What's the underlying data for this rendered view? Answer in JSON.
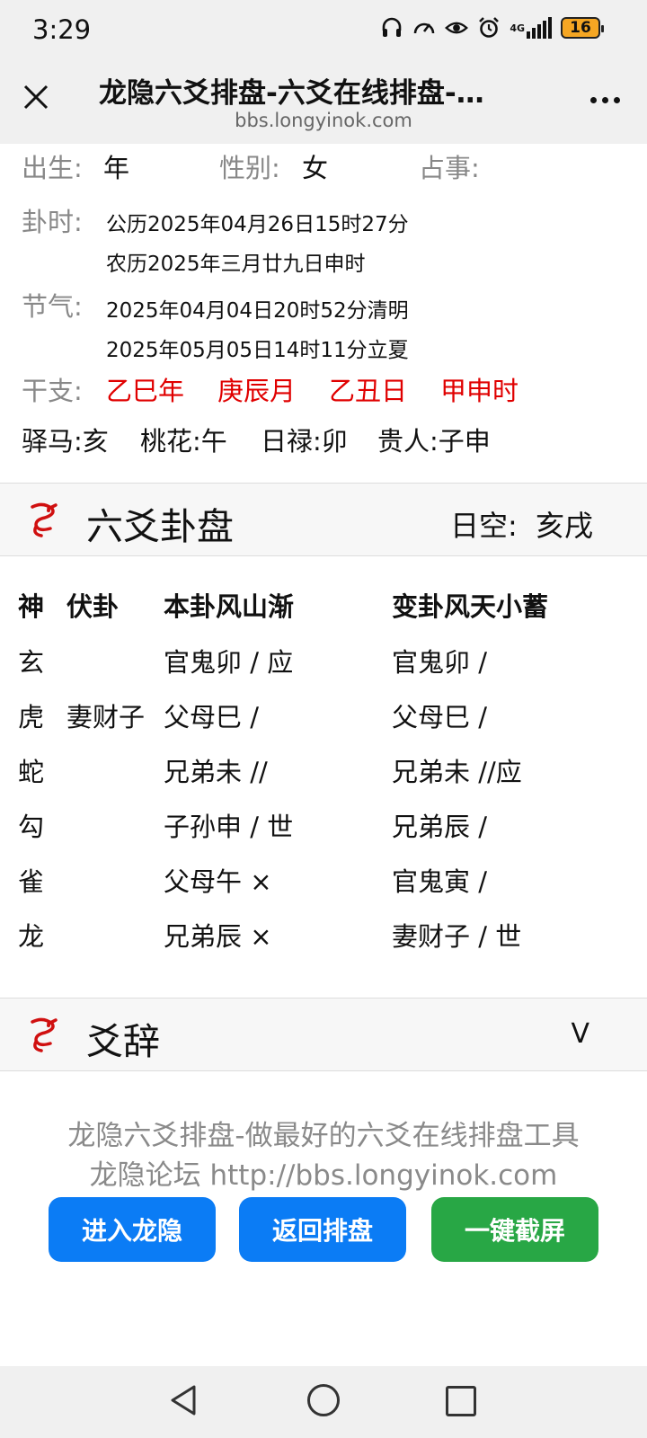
{
  "status_bar": {
    "time": "3:29",
    "icons": [
      "headphones-icon",
      "speed-icon",
      "eye-icon",
      "alarm-icon",
      "signal-icon"
    ],
    "network": "4G",
    "battery": "16",
    "battery_color": "#f5a623"
  },
  "browser": {
    "title": "龙隐六爻排盘-六爻在线排盘-…",
    "url": "bbs.longyinok.com"
  },
  "info": {
    "birth_label": "出生:",
    "birth_value": "年",
    "gender_label": "性别:",
    "gender_value": "女",
    "matter_label": "占事:",
    "gua_time_label": "卦时:",
    "gua_time_solar": "公历2025年04月26日15时27分",
    "gua_time_lunar": "农历2025年三月廿九日申时",
    "solar_term_label": "节气:",
    "solar_term_1": "2025年04月04日20时52分清明",
    "solar_term_2": "2025年05月05日14时11分立夏",
    "ganzhi_label": "干支:",
    "ganzhi": [
      "乙巳年",
      "庚辰月",
      "乙丑日",
      "甲申时"
    ],
    "ganzhi_color": "#e00000",
    "shensha": [
      "驿马:亥",
      "桃花:午",
      "日禄:卯",
      "贵人:子申"
    ]
  },
  "liuyao_section": {
    "title": "六爻卦盘",
    "kong_label": "日空:",
    "kong_value": "亥戌",
    "headers": {
      "shen": "神",
      "fu": "伏卦",
      "ben": "本卦风山渐",
      "bian": "变卦风天小蓄"
    },
    "rows": [
      {
        "shen": "玄",
        "fu": "",
        "ben": "官鬼卯 / 应",
        "bian": "官鬼卯 /"
      },
      {
        "shen": "虎",
        "fu": "妻财子",
        "ben": "父母巳 /",
        "bian": "父母巳 /"
      },
      {
        "shen": "蛇",
        "fu": "",
        "ben": "兄弟未 //",
        "bian": "兄弟未 //应"
      },
      {
        "shen": "勾",
        "fu": "",
        "ben": "子孙申 / 世",
        "bian": "兄弟辰 /"
      },
      {
        "shen": "雀",
        "fu": "",
        "ben": "父母午 ×",
        "bian": "官鬼寅 /"
      },
      {
        "shen": "龙",
        "fu": "",
        "ben": "兄弟辰 ×",
        "bian": "妻财子 / 世"
      }
    ]
  },
  "yaoci_section": {
    "title": "爻辞",
    "toggle": "V"
  },
  "footer": {
    "line1": "龙隐六爻排盘-做最好的六爻在线排盘工具",
    "line2": "龙隐论坛 http://bbs.longyinok.com",
    "buttons": {
      "enter": "进入龙隐",
      "back": "返回排盘",
      "screenshot": "一键截屏"
    }
  }
}
